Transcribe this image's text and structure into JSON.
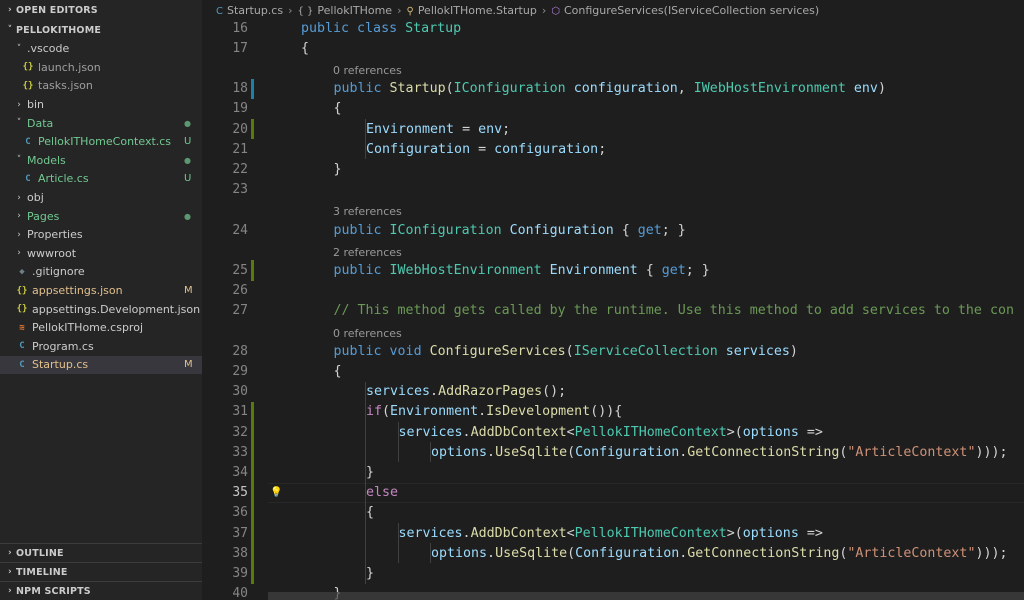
{
  "sidebar": {
    "open_editors": "OPEN EDITORS",
    "project": "PELLOKITHOME",
    "tree": [
      {
        "label": ".vscode",
        "indent": 1,
        "chev": "˅",
        "icon": "",
        "icon_name": "",
        "color": "#cccccc",
        "badge": ""
      },
      {
        "label": "launch.json",
        "indent": 2,
        "chev": "",
        "icon": "{}",
        "icon_name": "json-icon",
        "icon_color": "#cbcb41",
        "color": "#9e9e9e",
        "badge": ""
      },
      {
        "label": "tasks.json",
        "indent": 2,
        "chev": "",
        "icon": "{}",
        "icon_name": "json-icon",
        "icon_color": "#cbcb41",
        "color": "#9e9e9e",
        "badge": ""
      },
      {
        "label": "bin",
        "indent": 1,
        "chev": "›",
        "icon": "",
        "icon_name": "",
        "color": "#cccccc",
        "badge": ""
      },
      {
        "label": "Data",
        "indent": 1,
        "chev": "˅",
        "icon": "",
        "icon_name": "",
        "color": "#73c991",
        "badge": "",
        "dot": "●"
      },
      {
        "label": "PellokITHomeContext.cs",
        "indent": 2,
        "chev": "",
        "icon": "C",
        "icon_name": "csharp-icon",
        "icon_color": "#519aba",
        "color": "#73c991",
        "badge": "U"
      },
      {
        "label": "Models",
        "indent": 1,
        "chev": "˅",
        "icon": "",
        "icon_name": "",
        "color": "#73c991",
        "badge": "",
        "dot": "●"
      },
      {
        "label": "Article.cs",
        "indent": 2,
        "chev": "",
        "icon": "C",
        "icon_name": "csharp-icon",
        "icon_color": "#519aba",
        "color": "#73c991",
        "badge": "U"
      },
      {
        "label": "obj",
        "indent": 1,
        "chev": "›",
        "icon": "",
        "icon_name": "",
        "color": "#cccccc",
        "badge": ""
      },
      {
        "label": "Pages",
        "indent": 1,
        "chev": "›",
        "icon": "",
        "icon_name": "",
        "color": "#73c991",
        "badge": "",
        "dot": "●"
      },
      {
        "label": "Properties",
        "indent": 1,
        "chev": "›",
        "icon": "",
        "icon_name": "",
        "color": "#cccccc",
        "badge": ""
      },
      {
        "label": "wwwroot",
        "indent": 1,
        "chev": "›",
        "icon": "",
        "icon_name": "",
        "color": "#cccccc",
        "badge": ""
      },
      {
        "label": ".gitignore",
        "indent": 1,
        "chev": "",
        "icon": "◆",
        "icon_name": "git-icon",
        "icon_color": "#6d8086",
        "color": "#cccccc",
        "badge": ""
      },
      {
        "label": "appsettings.json",
        "indent": 1,
        "chev": "",
        "icon": "{}",
        "icon_name": "json-icon",
        "icon_color": "#cbcb41",
        "color": "#e2c08d",
        "badge": "M"
      },
      {
        "label": "appsettings.Development.json",
        "indent": 1,
        "chev": "",
        "icon": "{}",
        "icon_name": "json-icon",
        "icon_color": "#cbcb41",
        "color": "#cccccc",
        "badge": ""
      },
      {
        "label": "PellokITHome.csproj",
        "indent": 1,
        "chev": "",
        "icon": "≋",
        "icon_name": "rss-icon",
        "icon_color": "#e37933",
        "color": "#cccccc",
        "badge": ""
      },
      {
        "label": "Program.cs",
        "indent": 1,
        "chev": "",
        "icon": "C",
        "icon_name": "csharp-icon",
        "icon_color": "#519aba",
        "color": "#cccccc",
        "badge": ""
      },
      {
        "label": "Startup.cs",
        "indent": 1,
        "chev": "",
        "icon": "C",
        "icon_name": "csharp-icon",
        "icon_color": "#519aba",
        "color": "#e2c08d",
        "badge": "M",
        "selected": true
      }
    ],
    "bottom": [
      "OUTLINE",
      "TIMELINE",
      "NPM SCRIPTS"
    ]
  },
  "breadcrumb": [
    {
      "icon": "C",
      "text": "Startup.cs"
    },
    {
      "icon": "{ }",
      "text": "PellokITHome"
    },
    {
      "icon": "⚲",
      "text": "PellokITHome.Startup"
    },
    {
      "icon": "⬡",
      "text": "ConfigureServices(IServiceCollection services)"
    }
  ],
  "code": [
    {
      "type": "line",
      "num": "16",
      "indent": 1,
      "tokens": [
        [
          "kw",
          "public "
        ],
        [
          "kw",
          "class "
        ],
        [
          "ty",
          "Startup"
        ]
      ]
    },
    {
      "type": "line",
      "num": "17",
      "indent": 1,
      "tokens": [
        [
          "",
          "{"
        ]
      ]
    },
    {
      "type": "lens",
      "text": "0 references"
    },
    {
      "type": "line",
      "num": "18",
      "indent": 2,
      "mark": "#1b81a8",
      "tokens": [
        [
          "kw",
          "public "
        ],
        [
          "fn",
          "Startup"
        ],
        [
          "",
          "("
        ],
        [
          "ty",
          "IConfiguration "
        ],
        [
          "pm",
          "configuration"
        ],
        [
          "",
          ", "
        ],
        [
          "ty",
          "IWebHostEnvironment "
        ],
        [
          "pm",
          "env"
        ],
        [
          "",
          ")"
        ]
      ]
    },
    {
      "type": "line",
      "num": "19",
      "indent": 2,
      "tokens": [
        [
          "",
          "{"
        ]
      ]
    },
    {
      "type": "line",
      "num": "20",
      "indent": 3,
      "mark": "#587c0c",
      "tokens": [
        [
          "pm",
          "Environment"
        ],
        [
          "",
          " = "
        ],
        [
          "pm",
          "env"
        ],
        [
          "",
          ";"
        ]
      ]
    },
    {
      "type": "line",
      "num": "21",
      "indent": 3,
      "tokens": [
        [
          "pm",
          "Configuration"
        ],
        [
          "",
          " = "
        ],
        [
          "pm",
          "configuration"
        ],
        [
          "",
          ";"
        ]
      ]
    },
    {
      "type": "line",
      "num": "22",
      "indent": 2,
      "tokens": [
        [
          "",
          "}"
        ]
      ]
    },
    {
      "type": "line",
      "num": "23",
      "indent": 0,
      "tokens": []
    },
    {
      "type": "lens",
      "text": "3 references"
    },
    {
      "type": "line",
      "num": "24",
      "indent": 2,
      "tokens": [
        [
          "kw",
          "public "
        ],
        [
          "ty",
          "IConfiguration "
        ],
        [
          "pm",
          "Configuration"
        ],
        [
          "",
          " { "
        ],
        [
          "kw",
          "get"
        ],
        [
          "",
          "; }"
        ]
      ]
    },
    {
      "type": "lens",
      "text": "2 references"
    },
    {
      "type": "line",
      "num": "25",
      "indent": 2,
      "mark": "#587c0c",
      "tokens": [
        [
          "kw",
          "public "
        ],
        [
          "ty",
          "IWebHostEnvironment "
        ],
        [
          "pm",
          "Environment"
        ],
        [
          "",
          " { "
        ],
        [
          "kw",
          "get"
        ],
        [
          "",
          "; }"
        ]
      ]
    },
    {
      "type": "line",
      "num": "26",
      "indent": 0,
      "tokens": []
    },
    {
      "type": "line",
      "num": "27",
      "indent": 2,
      "tokens": [
        [
          "cm",
          "// This method gets called by the runtime. Use this method to add services to the con"
        ]
      ]
    },
    {
      "type": "lens",
      "text": "0 references"
    },
    {
      "type": "line",
      "num": "28",
      "indent": 2,
      "tokens": [
        [
          "kw",
          "public "
        ],
        [
          "kw",
          "void "
        ],
        [
          "fn",
          "ConfigureServices"
        ],
        [
          "",
          "("
        ],
        [
          "ty",
          "IServiceCollection "
        ],
        [
          "pm",
          "services"
        ],
        [
          "",
          ")"
        ]
      ]
    },
    {
      "type": "line",
      "num": "29",
      "indent": 2,
      "tokens": [
        [
          "",
          "{"
        ]
      ]
    },
    {
      "type": "line",
      "num": "30",
      "indent": 3,
      "tokens": [
        [
          "pm",
          "services"
        ],
        [
          "",
          "."
        ],
        [
          "fn",
          "AddRazorPages"
        ],
        [
          "",
          "();"
        ]
      ]
    },
    {
      "type": "line",
      "num": "31",
      "indent": 3,
      "mark": "#587c0c",
      "tokens": [
        [
          "ctl",
          "if"
        ],
        [
          "",
          "("
        ],
        [
          "pm",
          "Environment"
        ],
        [
          "",
          "."
        ],
        [
          "fn",
          "IsDevelopment"
        ],
        [
          "",
          "()){"
        ]
      ]
    },
    {
      "type": "line",
      "num": "32",
      "indent": 4,
      "mark": "#587c0c",
      "tokens": [
        [
          "pm",
          "services"
        ],
        [
          "",
          "."
        ],
        [
          "fn",
          "AddDbContext"
        ],
        [
          "",
          "<"
        ],
        [
          "ty",
          "PellokITHomeContext"
        ],
        [
          "",
          ">("
        ],
        [
          "pm",
          "options"
        ],
        [
          "",
          " =>"
        ]
      ]
    },
    {
      "type": "line",
      "num": "33",
      "indent": 5,
      "mark": "#587c0c",
      "tokens": [
        [
          "pm",
          "options"
        ],
        [
          "",
          "."
        ],
        [
          "fn",
          "UseSqlite"
        ],
        [
          "",
          "("
        ],
        [
          "pm",
          "Configuration"
        ],
        [
          "",
          "."
        ],
        [
          "fn",
          "GetConnectionString"
        ],
        [
          "",
          "("
        ],
        [
          "str",
          "\"ArticleContext\""
        ],
        [
          "",
          ")));"
        ]
      ]
    },
    {
      "type": "line",
      "num": "34",
      "indent": 3,
      "mark": "#587c0c",
      "tokens": [
        [
          "",
          "}"
        ]
      ]
    },
    {
      "type": "line",
      "num": "35",
      "indent": 3,
      "mark": "#587c0c",
      "bulb": true,
      "cur": true,
      "tokens": [
        [
          "ctl",
          "else"
        ]
      ]
    },
    {
      "type": "line",
      "num": "36",
      "indent": 3,
      "mark": "#587c0c",
      "tokens": [
        [
          "",
          "{"
        ]
      ]
    },
    {
      "type": "line",
      "num": "37",
      "indent": 4,
      "mark": "#587c0c",
      "tokens": [
        [
          "pm",
          "services"
        ],
        [
          "",
          "."
        ],
        [
          "fn",
          "AddDbContext"
        ],
        [
          "",
          "<"
        ],
        [
          "ty",
          "PellokITHomeContext"
        ],
        [
          "",
          ">("
        ],
        [
          "pm",
          "options"
        ],
        [
          "",
          " =>"
        ]
      ]
    },
    {
      "type": "line",
      "num": "38",
      "indent": 5,
      "mark": "#587c0c",
      "tokens": [
        [
          "pm",
          "options"
        ],
        [
          "",
          "."
        ],
        [
          "fn",
          "UseSqlite"
        ],
        [
          "",
          "("
        ],
        [
          "pm",
          "Configuration"
        ],
        [
          "",
          "."
        ],
        [
          "fn",
          "GetConnectionString"
        ],
        [
          "",
          "("
        ],
        [
          "str",
          "\"ArticleContext\""
        ],
        [
          "",
          ")));"
        ]
      ]
    },
    {
      "type": "line",
      "num": "39",
      "indent": 3,
      "mark": "#587c0c",
      "tokens": [
        [
          "",
          "}"
        ]
      ]
    },
    {
      "type": "line",
      "num": "40",
      "indent": 2,
      "tokens": [
        [
          "",
          "}"
        ]
      ]
    }
  ]
}
